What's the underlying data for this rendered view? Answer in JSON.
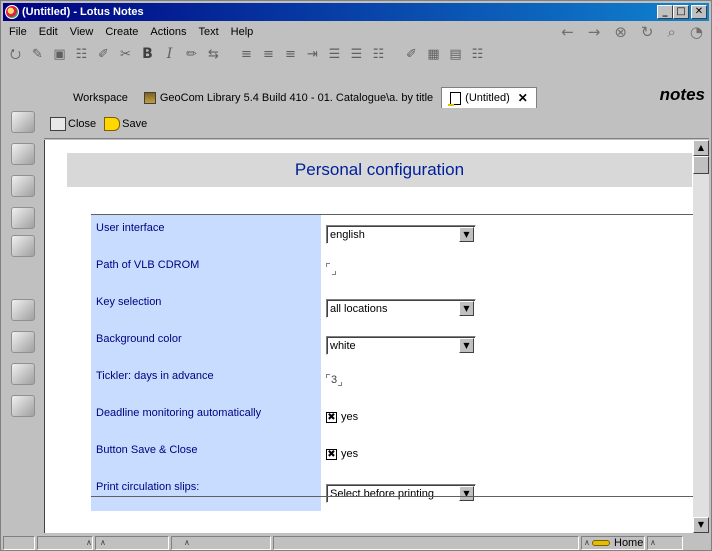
{
  "window": {
    "title": "(Untitled) - Lotus Notes"
  },
  "window_buttons": {
    "minimize": "_",
    "maximize": "□",
    "close": "✕"
  },
  "menu": {
    "items": [
      {
        "label": "File"
      },
      {
        "label": "Edit"
      },
      {
        "label": "View"
      },
      {
        "label": "Create"
      },
      {
        "label": "Actions"
      },
      {
        "label": "Text"
      },
      {
        "label": "Help"
      }
    ]
  },
  "nav_icons": [
    "back-icon",
    "forward-icon",
    "stop-icon",
    "refresh-icon",
    "search-icon",
    "globe-icon"
  ],
  "toolbar_icons": [
    "navigator-icon",
    "edit-icon",
    "properties-icon",
    "text-properties-icon",
    "font-icon",
    "attach-icon",
    "bold-icon",
    "italic-icon",
    "highlight-icon",
    "bullet-icon",
    "align-left-icon",
    "align-center-icon",
    "indent-icon",
    "outdent-icon",
    "list-bullet-icon",
    "list-number-icon",
    "spell-check-icon",
    "table-icon",
    "section-icon"
  ],
  "toolbar_glyphs": {
    "bold": "B",
    "italic": "I"
  },
  "tabs": [
    {
      "label": "Workspace"
    },
    {
      "label": "GeoCom Library 5.4 Build 410 - 01. Catalogue\\a. by title"
    },
    {
      "label": "(Untitled)",
      "close": "✕"
    }
  ],
  "brand": {
    "logo": "notes"
  },
  "actions": {
    "close": "Close",
    "save": "Save"
  },
  "document": {
    "title": "Personal configuration",
    "fields": [
      {
        "label": "User interface",
        "type": "select",
        "value": "english"
      },
      {
        "label": "Path of VLB CDROM",
        "type": "text",
        "value": ""
      },
      {
        "label": "Key selection",
        "type": "select",
        "value": "all locations"
      },
      {
        "label": "Background color",
        "type": "select",
        "value": "white"
      },
      {
        "label": "Tickler: days in advance",
        "type": "text",
        "value": "3"
      },
      {
        "label": "Deadline monitoring automatically",
        "type": "checkbox",
        "checked": true,
        "value": "yes"
      },
      {
        "label": "Button Save & Close",
        "type": "checkbox",
        "checked": true,
        "value": "yes"
      },
      {
        "label": "Print circulation slips:",
        "type": "select",
        "value": "Select before printing"
      }
    ]
  },
  "status": {
    "location": "Home"
  },
  "colors": {
    "title_text": "#00209a",
    "label_bg": "#c8dcff",
    "title_bar": "#000080"
  }
}
